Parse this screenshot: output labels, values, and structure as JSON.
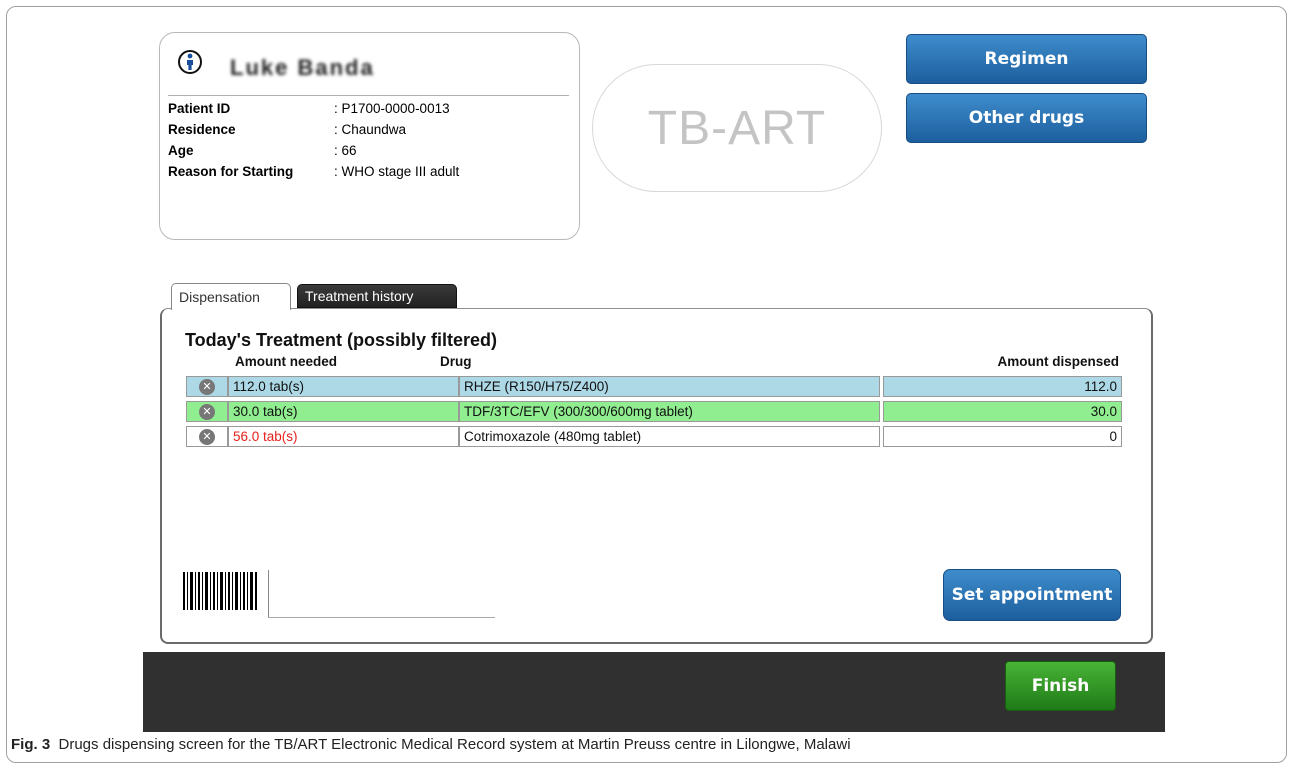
{
  "patient": {
    "name": "Luke Banda",
    "fields": [
      {
        "label": "Patient ID",
        "value": ": P1700-0000-0013"
      },
      {
        "label": "Residence",
        "value": ":  Chaundwa"
      },
      {
        "label": "Age",
        "value": ": 66"
      },
      {
        "label": "Reason for Starting",
        "value": ": WHO stage III adult"
      }
    ]
  },
  "logo": {
    "text": "TB-ART"
  },
  "buttons": {
    "regimen": "Regimen",
    "other_drugs": "Other drugs",
    "set_appointment": "Set appointment",
    "finish": "Finish"
  },
  "tabs": {
    "dispensation": "Dispensation",
    "history": "Treatment history"
  },
  "treatment": {
    "title": "Today's Treatment (possibly filtered)",
    "headers": {
      "needed": "Amount needed",
      "drug": "Drug",
      "amount": "Amount dispensed"
    },
    "rows": [
      {
        "needed": "112.0 tab(s)",
        "drug": "RHZE (R150/H75/Z400)",
        "amount": "112.0",
        "color": "#add8e6",
        "needed_color": "#111111"
      },
      {
        "needed": "30.0 tab(s)",
        "drug": "TDF/3TC/EFV (300/300/600mg tablet)",
        "amount": "30.0",
        "color": "#90ee90",
        "needed_color": "#111111"
      },
      {
        "needed": "56.0 tab(s)",
        "drug": "Cotrimoxazole (480mg tablet)",
        "amount": "0",
        "color": "#ffffff",
        "needed_color": "#e8201c"
      }
    ]
  },
  "caption": {
    "label": "Fig. 3",
    "text": "Drugs dispensing screen for the TB/ART Electronic Medical Record system at Martin Preuss centre in Lilongwe, Malawi"
  },
  "icons": {
    "remove": "remove-circle-icon",
    "person": "person-icon",
    "barcode": "barcode-icon"
  }
}
